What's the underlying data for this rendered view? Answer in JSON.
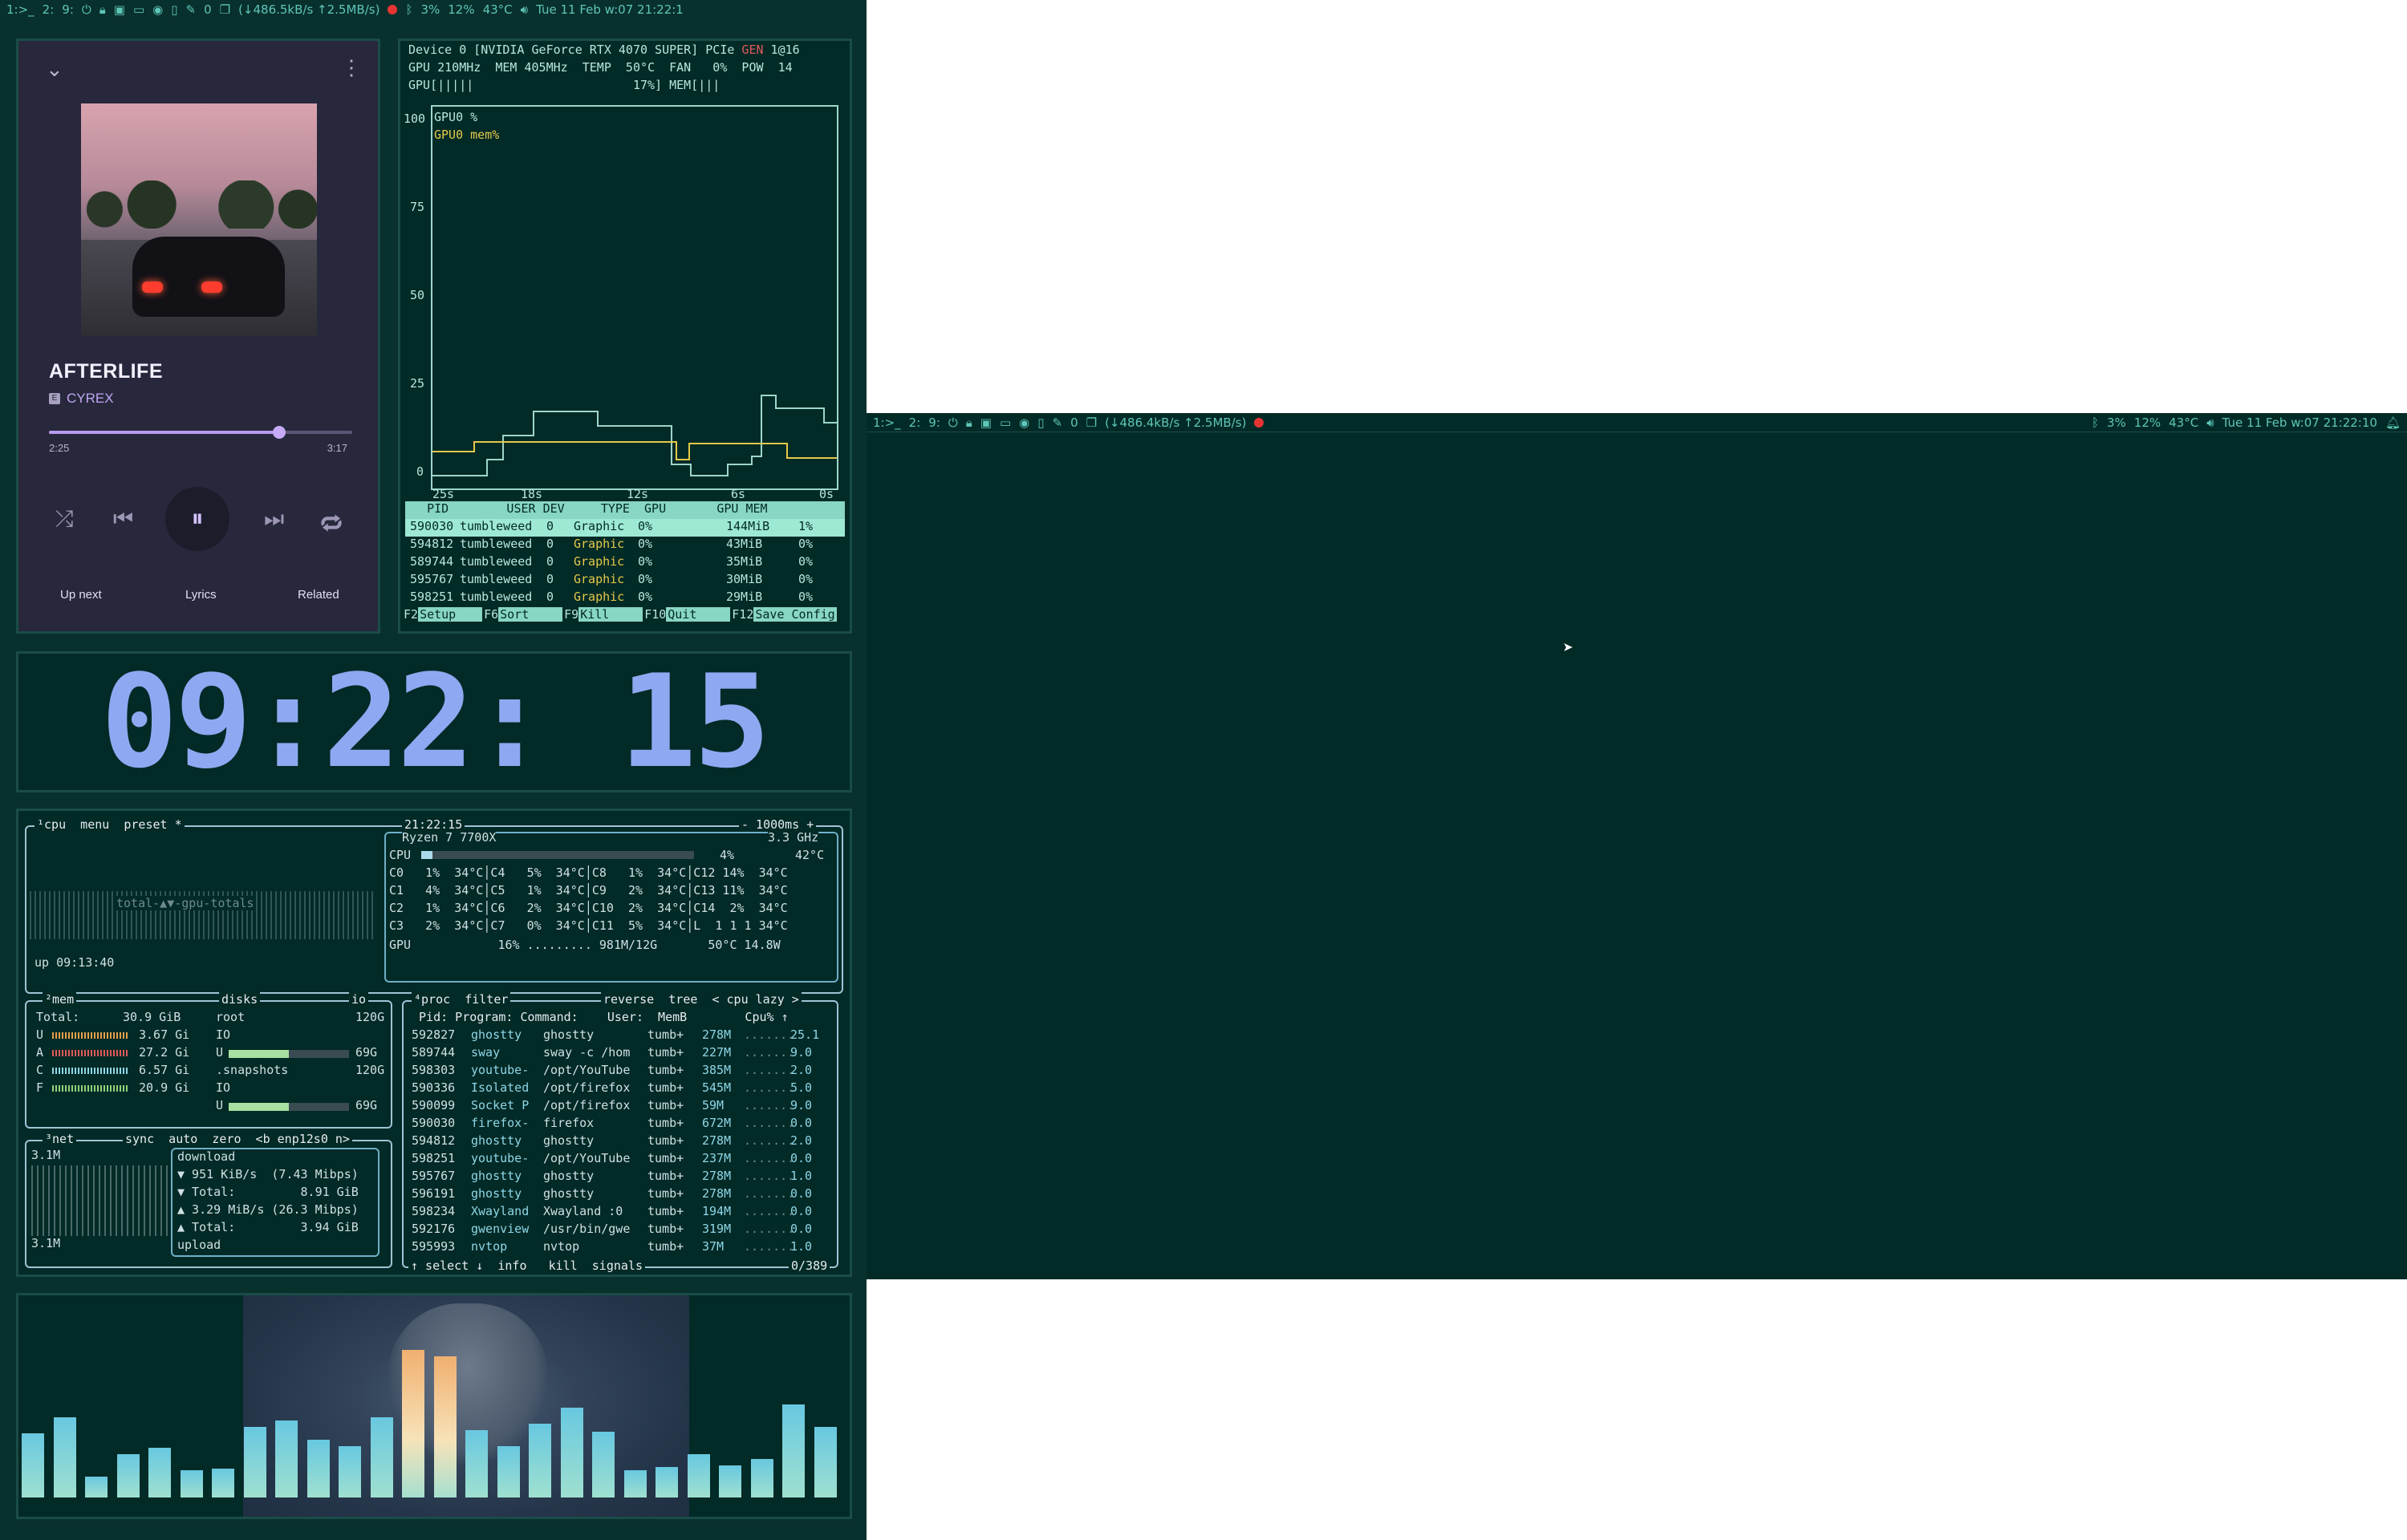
{
  "topbar_left": {
    "workspaces": [
      "1:>_",
      "2:",
      "9:"
    ],
    "network": "(↓486.5kB/s ↑2.5MB/s)",
    "cpu": "3%",
    "mem": "12%",
    "temp": "43°C",
    "clock": "Tue 11 Feb w:07 21:22:1",
    "trash_count": "0"
  },
  "topbar_right": {
    "workspaces": [
      "1:>_",
      "2:",
      "9:"
    ],
    "network": "(↓486.4kB/s ↑2.5MB/s)",
    "cpu": "3%",
    "mem": "12%",
    "temp": "43°C",
    "clock": "Tue 11 Feb w:07 21:22:10",
    "trash_count": "0"
  },
  "music": {
    "title": "AFTERLIFE",
    "explicit_badge": "E",
    "artist": "CYREX",
    "elapsed": "2:25",
    "duration": "3:17",
    "progress_fraction": 0.76,
    "tabs": [
      "Up next",
      "Lyrics",
      "Related"
    ]
  },
  "nvtop": {
    "line1a": "Device 0 [NVIDIA GeForce RTX 4070 SUPER] PCIe ",
    "line1b": "GEN",
    "line1c": " 1@16",
    "line2": "GPU 210MHz  MEM 405MHz  TEMP  50°C  FAN   0%  POW  14",
    "line3": "GPU[|||||                      17%] MEM[|||",
    "y_ticks": [
      "100",
      "75",
      "50",
      "25",
      "0"
    ],
    "x_ticks": [
      "25s",
      "18s",
      "12s",
      "6s",
      "0s"
    ],
    "legend": [
      "GPU0 %",
      "GPU0 mem%"
    ],
    "table_header": "   PID        USER DEV     TYPE  GPU       GPU MEM",
    "rows": [
      {
        "pid": "590030",
        "user": "tumbleweed",
        "dev": "0",
        "type": "Graphic",
        "gpu": "0%",
        "gpumem": "144MiB",
        "mem": "1%"
      },
      {
        "pid": "594812",
        "user": "tumbleweed",
        "dev": "0",
        "type": "Graphic",
        "gpu": "0%",
        "gpumem": "43MiB",
        "mem": "0%"
      },
      {
        "pid": "589744",
        "user": "tumbleweed",
        "dev": "0",
        "type": "Graphic",
        "gpu": "0%",
        "gpumem": "35MiB",
        "mem": "0%"
      },
      {
        "pid": "595767",
        "user": "tumbleweed",
        "dev": "0",
        "type": "Graphic",
        "gpu": "0%",
        "gpumem": "30MiB",
        "mem": "0%"
      },
      {
        "pid": "598251",
        "user": "tumbleweed",
        "dev": "0",
        "type": "Graphic",
        "gpu": "0%",
        "gpumem": "29MiB",
        "mem": "0%"
      }
    ],
    "fkeys": [
      {
        "key": "F2",
        "label": "Setup"
      },
      {
        "key": "F6",
        "label": "Sort"
      },
      {
        "key": "F9",
        "label": "Kill"
      },
      {
        "key": "F10",
        "label": "Quit"
      },
      {
        "key": "F12",
        "label": "Save Config"
      }
    ]
  },
  "clock": {
    "time": "09:22: 15"
  },
  "btop": {
    "cpu_tabs": "¹cpu  menu  preset *",
    "time": "21:22:15",
    "interval": "- 1000ms +",
    "cpu_model": "Ryzen 7 7700X",
    "cpu_freq": "3.3 GHz",
    "cpu_total": "CPU",
    "cpu_total_pct": "4%",
    "cpu_total_temp": "42°C",
    "cores": [
      "C0   1%  34°C│C4   5%  34°C│C8   1%  34°C│C12 14%  34°C",
      "C1   4%  34°C│C5   1%  34°C│C9   2%  34°C│C13 11%  34°C",
      "C2   1%  34°C│C6   2%  34°C│C10  2%  34°C│C14  2%  34°C",
      "C3   2%  34°C│C7   0%  34°C│C11  5%  34°C│L  1 1 1 34°C"
    ],
    "gpu_line": "GPU            16% ......... 981M/12G       50°C 14.8W",
    "graph_label": "total-▲▼-gpu-totals",
    "uptime": "up 09:13:40",
    "mem_title": "²mem",
    "mem_rows": [
      {
        "k": "Total:",
        "v": "30.9 GiB"
      },
      {
        "k": "U",
        "v": "3.67 Gi"
      },
      {
        "k": "A",
        "v": "27.2 Gi"
      },
      {
        "k": "C",
        "v": "6.57 Gi"
      },
      {
        "k": "F",
        "v": "20.9 Gi"
      }
    ],
    "disks_title": "disks",
    "io_label": "io",
    "disks": [
      {
        "name": "root",
        "size": "120G"
      },
      {
        "name": "IO",
        "size": ""
      },
      {
        "name": "U",
        "size": "69G"
      },
      {
        "name": ".snapshots",
        "size": "120G"
      },
      {
        "name": "IO",
        "size": ""
      },
      {
        "name": "U",
        "size": "69G"
      }
    ],
    "net_title": "³net",
    "net_opts": "sync  auto  zero  <b enp12s0 n>",
    "net_scale_top": "3.1M",
    "net_scale_bottom": "3.1M",
    "net_stats": [
      "download",
      "▼ 951 KiB/s  (7.43 Mibps)",
      "▼ Total:         8.91 GiB",
      "▲ 3.29 MiB/s (26.3 Mibps)",
      "▲ Total:         3.94 GiB",
      "upload"
    ],
    "proc_title": "⁴proc  filter",
    "proc_opts": "reverse  tree  < cpu lazy >",
    "proc_header": " Pid: Program: Command:    User:  MemB        Cpu% ↑",
    "procs": [
      {
        "pid": "592827",
        "prog": "ghostty",
        "cmd": "ghostty",
        "user": "tumb+",
        "mem": "278M",
        "cpu": "25.1"
      },
      {
        "pid": "589744",
        "prog": "sway",
        "cmd": "sway -c /hom",
        "user": "tumb+",
        "mem": "227M",
        "cpu": "9.0"
      },
      {
        "pid": "598303",
        "prog": "youtube-",
        "cmd": "/opt/YouTube",
        "user": "tumb+",
        "mem": "385M",
        "cpu": "2.0"
      },
      {
        "pid": "590336",
        "prog": "Isolated",
        "cmd": "/opt/firefox",
        "user": "tumb+",
        "mem": "545M",
        "cpu": "5.0"
      },
      {
        "pid": "590099",
        "prog": "Socket P",
        "cmd": "/opt/firefox",
        "user": "tumb+",
        "mem": "59M",
        "cpu": "9.0"
      },
      {
        "pid": "590030",
        "prog": "firefox-",
        "cmd": "firefox",
        "user": "tumb+",
        "mem": "672M",
        "cpu": "0.0"
      },
      {
        "pid": "594812",
        "prog": "ghostty",
        "cmd": "ghostty",
        "user": "tumb+",
        "mem": "278M",
        "cpu": "2.0"
      },
      {
        "pid": "598251",
        "prog": "youtube-",
        "cmd": "/opt/YouTube",
        "user": "tumb+",
        "mem": "237M",
        "cpu": "0.0"
      },
      {
        "pid": "595767",
        "prog": "ghostty",
        "cmd": "ghostty",
        "user": "tumb+",
        "mem": "278M",
        "cpu": "1.0"
      },
      {
        "pid": "596191",
        "prog": "ghostty",
        "cmd": "ghostty",
        "user": "tumb+",
        "mem": "278M",
        "cpu": "0.0"
      },
      {
        "pid": "598234",
        "prog": "Xwayland",
        "cmd": "Xwayland :0",
        "user": "tumb+",
        "mem": "194M",
        "cpu": "0.0"
      },
      {
        "pid": "592176",
        "prog": "gwenview",
        "cmd": "/usr/bin/gwe",
        "user": "tumb+",
        "mem": "319M",
        "cpu": "0.0"
      },
      {
        "pid": "595993",
        "prog": "nvtop",
        "cmd": "nvtop",
        "user": "tumb+",
        "mem": "37M",
        "cpu": "1.0"
      }
    ],
    "proc_footer": "↑ select ↓  info   kill  signals",
    "proc_count": "0/389"
  },
  "colors": {
    "bg_dark": "#022a26",
    "accent_teal": "#88d6c4",
    "accent_purple": "#b89bf0",
    "clock_blue": "#8ea9f2"
  }
}
